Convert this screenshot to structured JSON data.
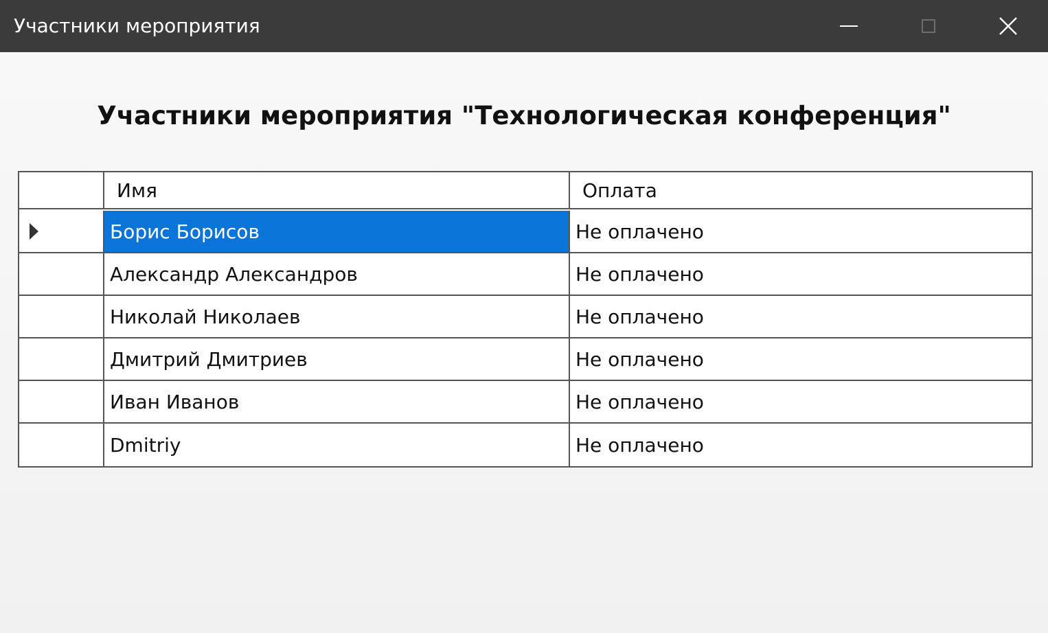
{
  "window": {
    "title": "Участники мероприятия",
    "controls": {
      "minimize_icon": "minimize-icon",
      "maximize_icon": "maximize-icon",
      "close_icon": "close-icon",
      "close_glyph": "✕"
    }
  },
  "heading": "Участники мероприятия \"Технологическая конференция\"",
  "table": {
    "columns": [
      "Имя",
      "Оплата"
    ],
    "selected_row": 0,
    "selection_color": "#0a74d9",
    "rows": [
      {
        "name": "Борис Борисов",
        "payment": "Не оплачено"
      },
      {
        "name": "Александр Александров",
        "payment": "Не оплачено"
      },
      {
        "name": "Николай Николаев",
        "payment": "Не оплачено"
      },
      {
        "name": "Дмитрий Дмитриев",
        "payment": "Не оплачено"
      },
      {
        "name": "Иван Иванов",
        "payment": "Не оплачено"
      },
      {
        "name": "Dmitriy",
        "payment": "Не оплачено"
      }
    ]
  }
}
